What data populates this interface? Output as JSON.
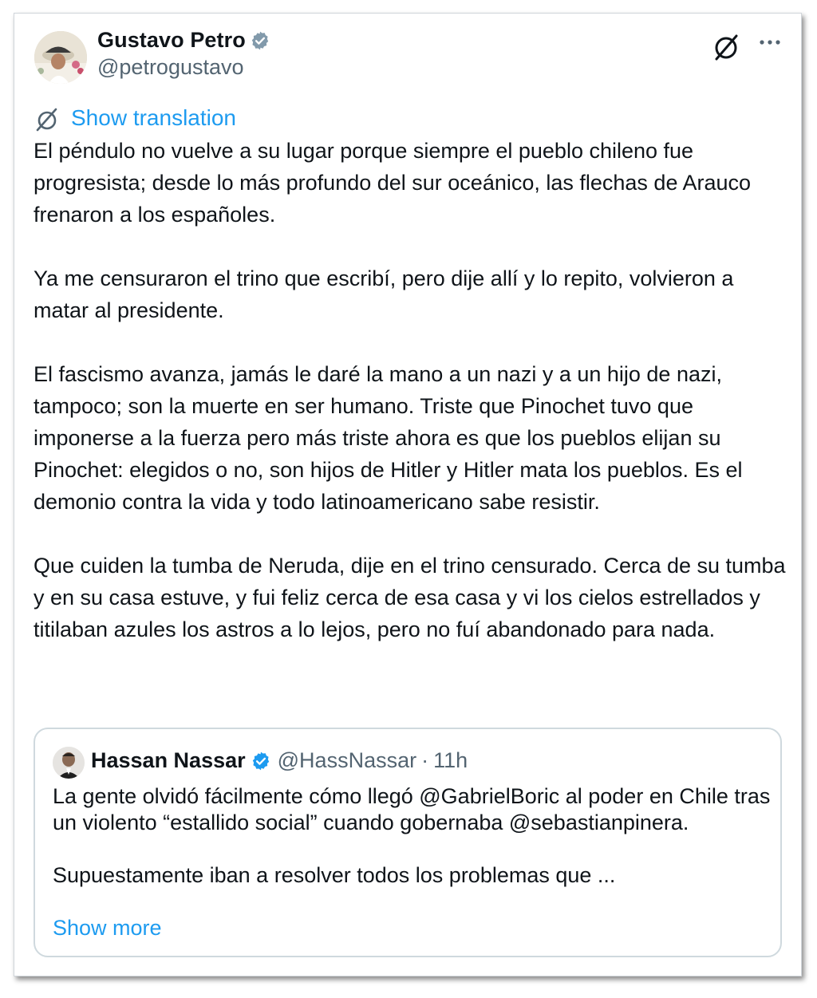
{
  "author": {
    "name": "Gustavo Petro",
    "handle": "@petrogustavo",
    "avatar_icon": "profile-photo",
    "verified_icon": "verified-badge-icon"
  },
  "header_actions": {
    "translate_icon": "grok-slash-icon",
    "more_icon": "more-dots-icon"
  },
  "translation": {
    "icon": "translate-slash-icon",
    "label": "Show translation"
  },
  "tweet": {
    "text": "El péndulo no vuelve a su lugar porque siempre el pueblo chileno fue progresista; desde lo más profundo del sur oceánico, las flechas de Arauco frenaron a los españoles.\n\nYa me censuraron el trino que escribí, pero dije allí y lo repito, volvieron a matar al presidente.\n\nEl fascismo avanza, jamás le daré la mano a un nazi y a un hijo de nazi, tampoco; son la muerte en ser humano. Triste que Pinochet tuvo que imponerse a la fuerza pero más triste ahora es que  los pueblos elijan su Pinochet: elegidos o no, son hijos de Hitler y Hitler mata los pueblos. Es el demonio contra la vida y todo latinoamericano sabe resistir.\n\nQue cuiden la tumba de Neruda, dije en el trino censurado. Cerca de su tumba y en su casa estuve, y fui feliz cerca de esa casa y vi los cielos estrellados y titilaban azules los astros a lo lejos, pero no fuí abandonado para nada."
  },
  "quoted": {
    "name": "Hassan Nassar",
    "handle": "@HassNassar",
    "separator": "·",
    "time": "11h",
    "text": "La gente olvidó fácilmente cómo llegó @GabrielBoric al poder en Chile tras un violento “estallido social” cuando gobernaba @sebastianpinera.\n\nSupuestamente iban a resolver todos los problemas que ...",
    "show_more": "Show more"
  },
  "colors": {
    "link": "#1d9bf0",
    "secondary": "#536471",
    "border": "#cfd9de"
  }
}
